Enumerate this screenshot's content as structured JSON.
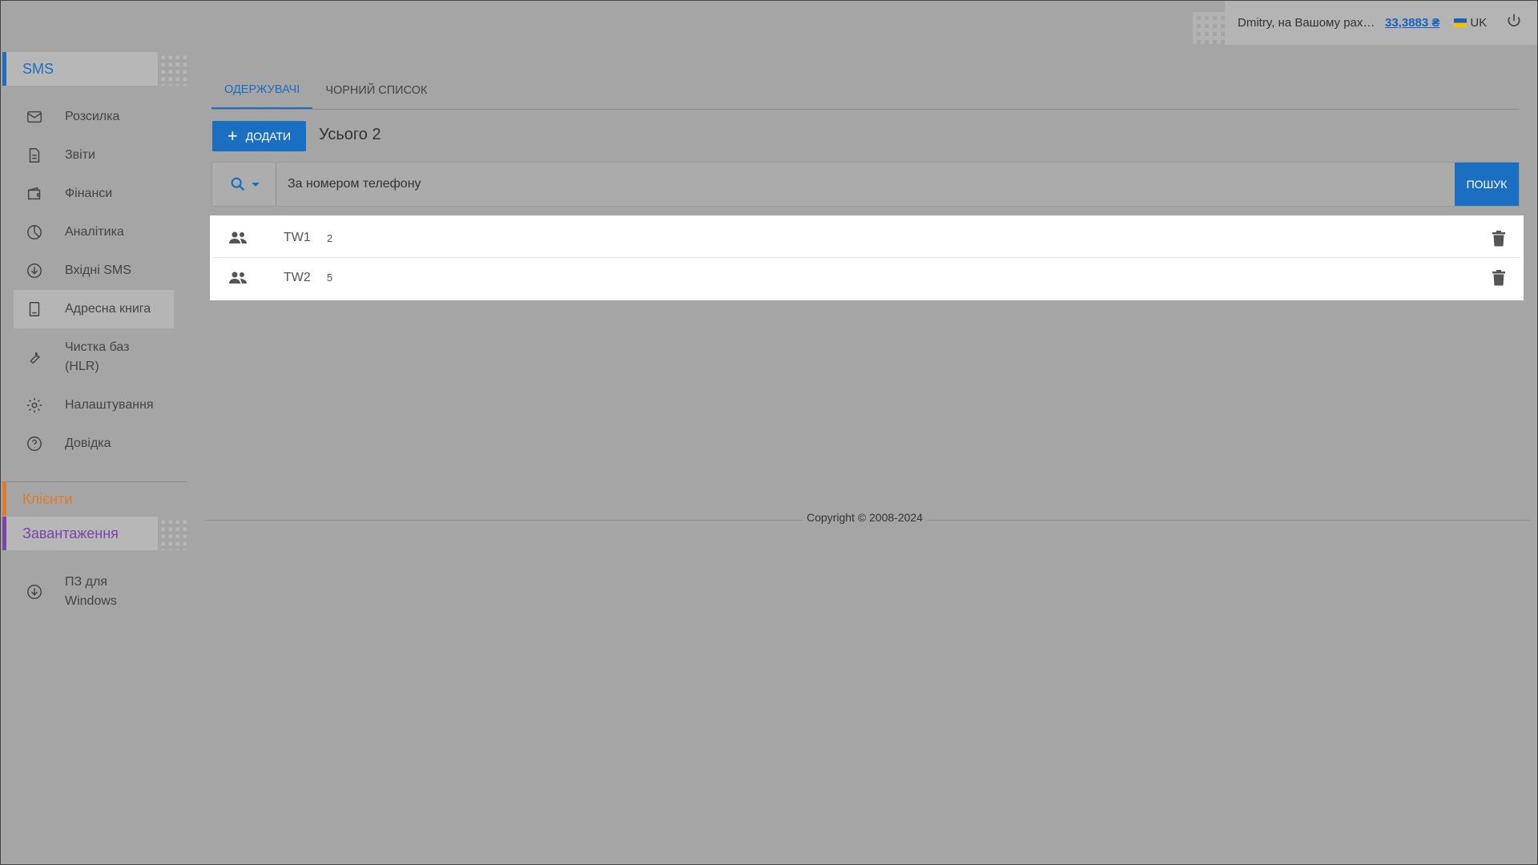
{
  "header": {
    "user_message": "Dmitry, на Вашому раху…",
    "balance": "33,3883 ₴",
    "language": "UK"
  },
  "sidebar": {
    "sms_section": "SMS",
    "items": [
      {
        "label": "Розсилка",
        "icon": "envelope-icon"
      },
      {
        "label": "Звіти",
        "icon": "document-icon"
      },
      {
        "label": "Фінанси",
        "icon": "wallet-icon"
      },
      {
        "label": "Аналітика",
        "icon": "pie-chart-icon"
      },
      {
        "label": "Вхідні SMS",
        "icon": "download-circle-icon"
      },
      {
        "label": "Адресна книга",
        "icon": "address-book-icon"
      },
      {
        "label": "Чистка баз (HLR)",
        "icon": "wrench-icon"
      },
      {
        "label": "Налаштування",
        "icon": "gear-icon"
      },
      {
        "label": "Довідка",
        "icon": "help-bubble-icon"
      }
    ],
    "clients_section": "Клієнти",
    "downloads_section": "Завантаження",
    "download_items": [
      {
        "label": "ПЗ для Windows",
        "icon": "download-circle-icon"
      }
    ]
  },
  "main": {
    "tabs": [
      {
        "label": "Одержувачі"
      },
      {
        "label": "Чорний список"
      }
    ],
    "add_label": "Додати",
    "total_label": "Усього 2",
    "search": {
      "placeholder": "За номером телефону",
      "button": "Пошук"
    },
    "groups": [
      {
        "name": "TW1",
        "count": "2"
      },
      {
        "name": "TW2",
        "count": "5"
      }
    ]
  },
  "footer": {
    "copyright": "Copyright © 2008-2024"
  },
  "colors": {
    "accent": "#1a6fc2",
    "clients": "#e07b2a",
    "downloads": "#7b46a8"
  }
}
